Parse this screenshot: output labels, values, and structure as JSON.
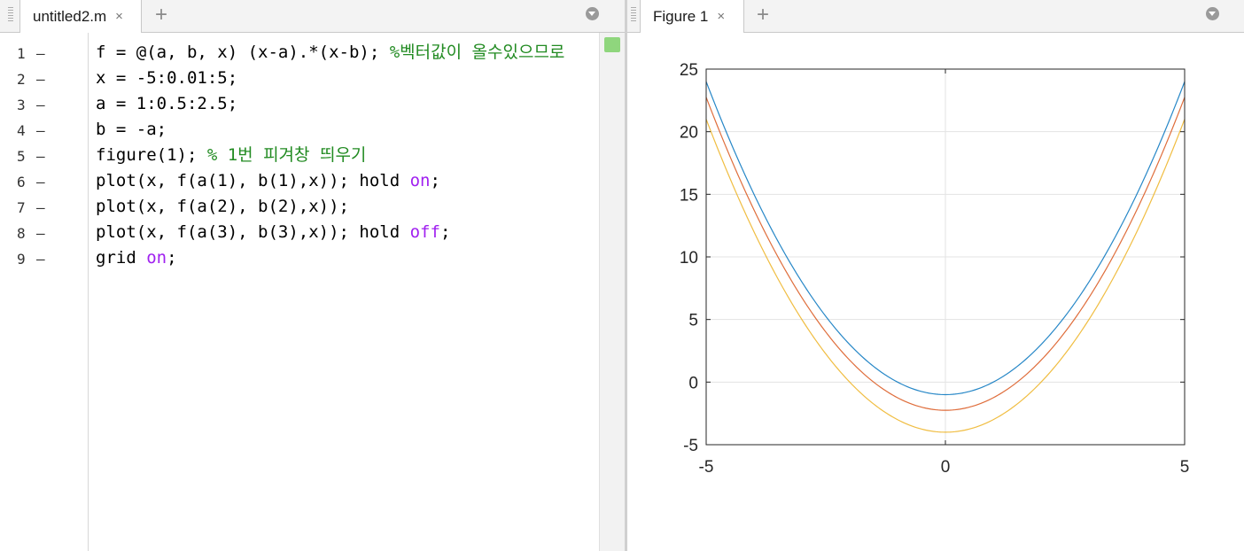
{
  "editor": {
    "tab": {
      "label": "untitled2.m",
      "close_glyph": "×"
    },
    "add_tab_glyph": "+",
    "menu_icon": "dropdown-circle-icon",
    "lines": [
      {
        "num": "1",
        "dash": "–",
        "segs": [
          {
            "t": "f = @(a, b, x) (x-a).*(x-b); ",
            "c": "code"
          },
          {
            "t": "%벡터값이 올수있으므로",
            "c": "cmt"
          }
        ]
      },
      {
        "num": "2",
        "dash": "–",
        "segs": [
          {
            "t": "x = -5:0.01:5;",
            "c": "code"
          }
        ]
      },
      {
        "num": "3",
        "dash": "–",
        "segs": [
          {
            "t": "a = 1:0.5:2.5;",
            "c": "code"
          }
        ]
      },
      {
        "num": "4",
        "dash": "–",
        "segs": [
          {
            "t": "b = -a;",
            "c": "code"
          }
        ]
      },
      {
        "num": "5",
        "dash": "–",
        "segs": [
          {
            "t": "figure(1); ",
            "c": "code"
          },
          {
            "t": "% 1번 피겨창 띄우기",
            "c": "cmt"
          }
        ]
      },
      {
        "num": "6",
        "dash": "–",
        "segs": [
          {
            "t": "plot(x, f(a(1), b(1),x)); hold ",
            "c": "code"
          },
          {
            "t": "on",
            "c": "kw"
          },
          {
            "t": ";",
            "c": "code"
          }
        ]
      },
      {
        "num": "7",
        "dash": "–",
        "segs": [
          {
            "t": "plot(x, f(a(2), b(2),x));",
            "c": "code"
          }
        ]
      },
      {
        "num": "8",
        "dash": "–",
        "segs": [
          {
            "t": "plot(x, f(a(3), b(3),x)); hold ",
            "c": "code"
          },
          {
            "t": "off",
            "c": "kw"
          },
          {
            "t": ";",
            "c": "code"
          }
        ]
      },
      {
        "num": "9",
        "dash": "–",
        "segs": [
          {
            "t": "grid ",
            "c": "code"
          },
          {
            "t": "on",
            "c": "kw"
          },
          {
            "t": ";",
            "c": "code"
          }
        ]
      }
    ],
    "colors": {
      "comment": "#228b22",
      "keyword": "#a020f0",
      "status_ok": "#8fd67d"
    }
  },
  "figure": {
    "tab": {
      "label": "Figure 1",
      "close_glyph": "×"
    },
    "add_tab_glyph": "+",
    "menu_icon": "dropdown-circle-icon"
  },
  "chart_data": {
    "type": "line",
    "title": "",
    "xlabel": "",
    "ylabel": "",
    "xlim": [
      -5,
      5
    ],
    "ylim": [
      -5,
      25
    ],
    "xticks": [
      -5,
      0,
      5
    ],
    "yticks": [
      -5,
      0,
      5,
      10,
      15,
      20,
      25
    ],
    "grid": true,
    "legend": null,
    "functions": "y = (x - a)(x - b) with b = -a",
    "series": [
      {
        "a": 1.0,
        "b": -1.0,
        "color": "#0072BD",
        "x": [
          -5,
          -2.5,
          0,
          2.5,
          5
        ],
        "y": [
          24,
          5.25,
          -1,
          5.25,
          24
        ]
      },
      {
        "a": 1.5,
        "b": -1.5,
        "color": "#D95319",
        "x": [
          -5,
          -2.5,
          0,
          2.5,
          5
        ],
        "y": [
          22.75,
          4,
          -2.25,
          4,
          22.75
        ]
      },
      {
        "a": 2.0,
        "b": -2.0,
        "color": "#EDB120",
        "x": [
          -5,
          -2.5,
          0,
          2.5,
          5
        ],
        "y": [
          21,
          2.25,
          -4,
          2.25,
          21
        ]
      }
    ]
  }
}
